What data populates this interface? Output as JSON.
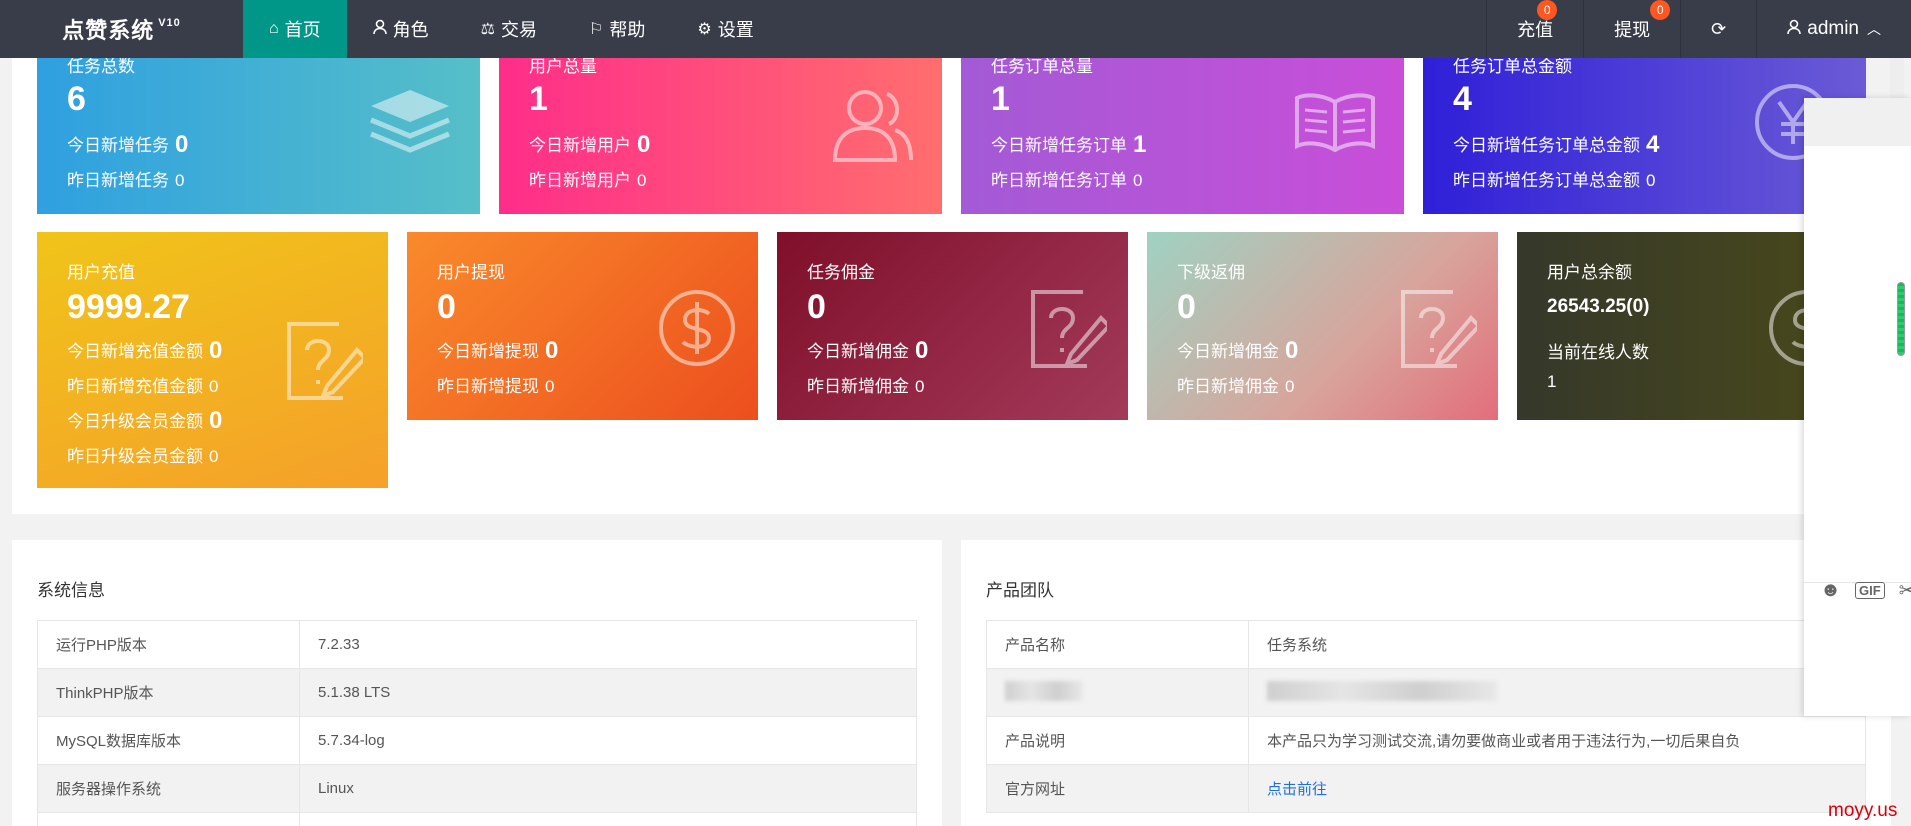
{
  "nav": {
    "brand": "点赞系统",
    "version": "V10",
    "items": [
      {
        "label": "首页",
        "icon": "home-icon"
      },
      {
        "label": "角色",
        "icon": "user-icon"
      },
      {
        "label": "交易",
        "icon": "scale-icon"
      },
      {
        "label": "帮助",
        "icon": "flag-icon"
      },
      {
        "label": "设置",
        "icon": "gear-icon"
      }
    ],
    "right": {
      "recharge": "充值",
      "recharge_badge": "0",
      "withdraw": "提现",
      "withdraw_badge": "0",
      "user": "admin"
    }
  },
  "cards_row1": [
    {
      "title": "任务总数",
      "value": "6",
      "line1_label": "今日新增任务",
      "line1_value": "0",
      "line2_label": "昨日新增任务",
      "line2_value": "0",
      "icon": "layers-icon"
    },
    {
      "title": "用户总量",
      "value": "1",
      "line1_label": "今日新增用户",
      "line1_value": "0",
      "line2_label": "昨日新增用户",
      "line2_value": "0",
      "icon": "users-icon"
    },
    {
      "title": "任务订单总量",
      "value": "1",
      "line1_label": "今日新增任务订单",
      "line1_value": "1",
      "line2_label": "昨日新增任务订单",
      "line2_value": "0",
      "icon": "book-icon"
    },
    {
      "title": "任务订单总金额",
      "value": "4",
      "line1_label": "今日新增任务订单总金额",
      "line1_value": "4",
      "line2_label": "昨日新增任务订单总金额",
      "line2_value": "0",
      "icon": "yen-icon"
    }
  ],
  "cards_row2": [
    {
      "title": "用户充值",
      "value": "9999.27",
      "lines": [
        {
          "label": "今日新增充值金额",
          "value": "0",
          "big": true
        },
        {
          "label": "昨日新增充值金额",
          "value": "0",
          "big": false
        },
        {
          "label": "今日升级会员金额",
          "value": "0",
          "big": true
        },
        {
          "label": "昨日升级会员金额",
          "value": "0",
          "big": false
        }
      ],
      "icon": "edit-question-icon"
    },
    {
      "title": "用户提现",
      "value": "0",
      "lines": [
        {
          "label": "今日新增提现",
          "value": "0",
          "big": true
        },
        {
          "label": "昨日新增提现",
          "value": "0",
          "big": false
        }
      ],
      "icon": "dollar-icon"
    },
    {
      "title": "任务佣金",
      "value": "0",
      "lines": [
        {
          "label": "今日新增佣金",
          "value": "0",
          "big": true
        },
        {
          "label": "昨日新增佣金",
          "value": "0",
          "big": false
        }
      ],
      "icon": "edit-question-icon"
    },
    {
      "title": "下级返佣",
      "value": "0",
      "lines": [
        {
          "label": "今日新增佣金",
          "value": "0",
          "big": true
        },
        {
          "label": "昨日新增佣金",
          "value": "0",
          "big": false
        }
      ],
      "icon": "edit-question-icon"
    },
    {
      "title": "用户总余额",
      "value": "26543.25(0)",
      "lines": [
        {
          "label": "当前在线人数",
          "value": "",
          "big": false
        },
        {
          "label": "1",
          "value": "",
          "big": false
        }
      ],
      "icon": "dollar-icon"
    }
  ],
  "system_info": {
    "title": "系统信息",
    "rows": [
      [
        "运行PHP版本",
        "7.2.33"
      ],
      [
        "ThinkPHP版本",
        "5.1.38 LTS"
      ],
      [
        "MySQL数据库版本",
        "5.7.34-log"
      ],
      [
        "服务器操作系统",
        "Linux"
      ]
    ]
  },
  "product_team": {
    "title": "产品团队",
    "rows": [
      [
        "产品名称",
        "任务系统"
      ],
      [
        "",
        ""
      ],
      [
        "产品说明",
        "本产品只为学习测试交流,请勿要做商业或者用于违法行为,一切后果自负"
      ],
      [
        "官方网址",
        "点击前往"
      ]
    ]
  },
  "watermark": "moyy.us",
  "chat_tools": {
    "gif": "GIF"
  }
}
